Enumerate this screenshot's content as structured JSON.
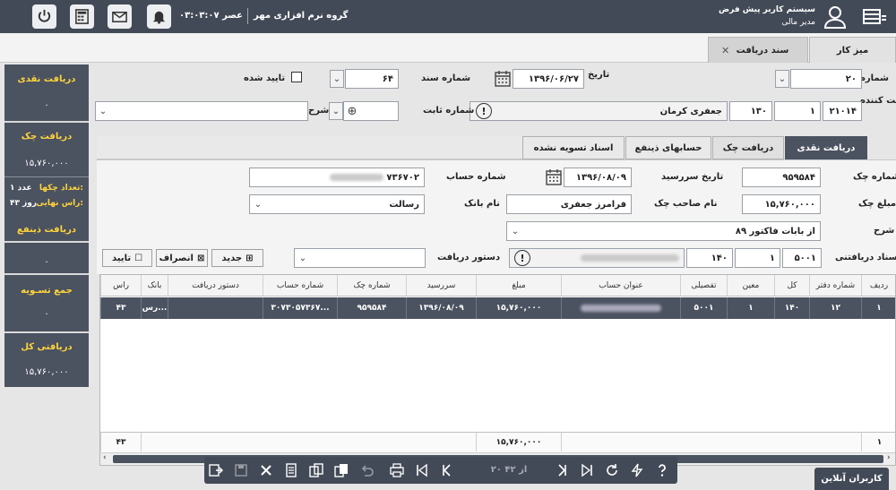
{
  "header": {
    "system_title": "سیستم کاربر پیش فرض",
    "user_role": "مدیر مالی",
    "company": "گروه نرم افزاری مهر",
    "clock": "۰۳:۰۳:۰۷ عصر"
  },
  "tabs": [
    {
      "label": "میز کار"
    },
    {
      "label": "سند دریافت"
    }
  ],
  "sidebar": {
    "cash_title": "دریافت نقدی",
    "cash_value": "۰",
    "cheque_title": "دریافت چک",
    "cheque_value": "۱۵,۷۶۰,۰۰۰",
    "cheque_count_label": "تعداد چکها:",
    "cheque_count_value": "۱ عدد",
    "due_label": "راس نهایی:",
    "due_value": "۴۳ روز",
    "other_title": "دریافت ذینفع",
    "other_value": "۰",
    "settle_title": "جمع تسـویه",
    "settle_value": "۰",
    "total_title": "دریافتی کل",
    "total_value": "۱۵,۷۶۰,۰۰۰"
  },
  "form": {
    "number_label": "شماره",
    "number_value": "۲۰",
    "doc_number_label": "شماره سند",
    "doc_number_value": "۶۴",
    "confirmed_label": "تایید شده",
    "date_label": "تاریخ",
    "date_value": "۱۳۹۶/۰۶/۲۷",
    "payer_label": "پرداخت کننده",
    "payer_code1": "۲۱۰۱۴",
    "payer_code2": "۱",
    "payer_code3": "۱۳۰",
    "payer_name": "جعفری کرمان",
    "fixed_number_label": "شماره ثابت",
    "desc_label": "شرح"
  },
  "inner_tabs": [
    {
      "label": "دریافت نقدی"
    },
    {
      "label": "دریافت چک"
    },
    {
      "label": "حسابهای ذینفع"
    },
    {
      "label": "اسناد تسویه نشده"
    }
  ],
  "cheque": {
    "cheque_no_label": "شماره چک",
    "cheque_no_value": "۹۵۹۵۸۴",
    "due_date_label": "تاریخ سررسید",
    "due_date_value": "۱۳۹۶/۰۸/۰۹",
    "account_no_label": "شماره حساب",
    "account_no_value": "۷۳۶۷۰۲",
    "amount_label": "مبلغ چک",
    "amount_value": "۱۵,۷۶۰,۰۰۰",
    "owner_label": "نام صاحب چک",
    "owner_value": "فرامرز جعفری",
    "bank_label": "نام بانک",
    "bank_value": "رسالت",
    "desc_label": "شرح",
    "desc_value": "از بابات فاکتور ۸۹",
    "docs_label": "اسناد دریافتنی",
    "docs_v1": "۵۰۰۱",
    "docs_v2": "۱",
    "docs_v3": "۱۴۰",
    "order_label": "دستور دریافت",
    "btn_new": "جدید",
    "btn_cancel": "انصراف",
    "btn_ok": "تایید"
  },
  "grid": {
    "headers": [
      "ردیف",
      "شماره دفتر",
      "کل",
      "معین",
      "تفصیلی",
      "عنوان حساب",
      "مبلغ",
      "سررسید",
      "شماره چک",
      "شماره حساب",
      "دستور دریافت",
      "بانک",
      "راس"
    ],
    "row": [
      "۱",
      "۱۲",
      "۱۴۰",
      "۱",
      "۵۰۰۱",
      "",
      "۱۵,۷۶۰,۰۰۰",
      "۱۳۹۶/۰۸/۰۹",
      "۹۵۹۵۸۴",
      "۳۰۷۳۰۵۷۳۶۷...",
      "",
      "رس...",
      "۴۳"
    ],
    "footer_row_no": "۱",
    "footer_amount": "۱۵,۷۶۰,۰۰۰",
    "footer_ras": "۴۳"
  },
  "pager": {
    "text": "۲۰ از ۴۲"
  },
  "online_users": "کاربران آنلاین"
}
